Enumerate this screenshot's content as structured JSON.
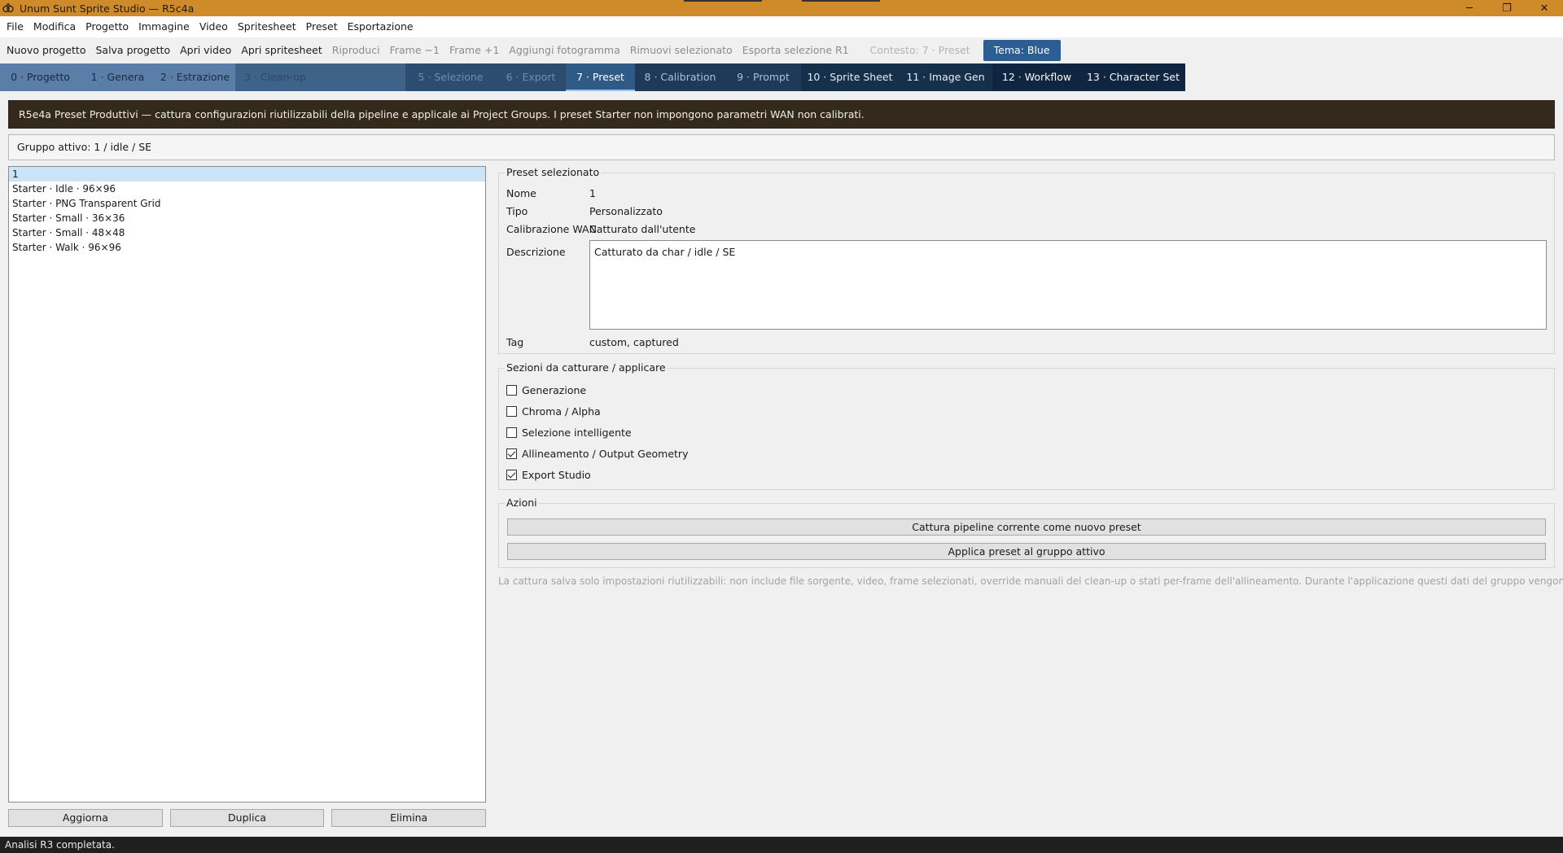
{
  "window": {
    "title": "Unum Sunt Sprite Studio — R5c4a",
    "controls": {
      "minimize": "─",
      "maximize": "❐",
      "close": "✕"
    }
  },
  "menu": [
    "File",
    "Modifica",
    "Progetto",
    "Immagine",
    "Video",
    "Spritesheet",
    "Preset",
    "Esportazione"
  ],
  "toolbar": {
    "items": [
      {
        "label": "Nuovo progetto",
        "enabled": true
      },
      {
        "label": "Salva progetto",
        "enabled": true
      },
      {
        "label": "Apri video",
        "enabled": true
      },
      {
        "label": "Apri spritesheet",
        "enabled": true
      },
      {
        "label": "Riproduci",
        "enabled": false
      },
      {
        "label": "Frame −1",
        "enabled": false
      },
      {
        "label": "Frame +1",
        "enabled": false
      },
      {
        "label": "Aggiungi fotogramma",
        "enabled": false
      },
      {
        "label": "Rimuovi selezionato",
        "enabled": false
      },
      {
        "label": "Esporta selezione R1",
        "enabled": false
      }
    ],
    "context": "Contesto: 7 · Preset",
    "theme_button": "Tema: Blue"
  },
  "tabs": [
    {
      "label": "0 · Progetto",
      "style": "t-light"
    },
    {
      "label": "1 · Genera",
      "style": "t-light"
    },
    {
      "label": "2 · Estrazione",
      "style": "t-light"
    },
    {
      "label": "3 · Clean-up",
      "style": "t-mid"
    },
    {
      "label": "",
      "style": "t-mid"
    },
    {
      "label": "5 · Selezione",
      "style": "t-dark"
    },
    {
      "label": "6 · Export",
      "style": "t-dark"
    },
    {
      "label": "7 · Preset",
      "style": "t-active"
    },
    {
      "label": "8 · Calibration",
      "style": "t-navy"
    },
    {
      "label": "9 · Prompt",
      "style": "t-navy"
    },
    {
      "label": "10 · Sprite Sheet",
      "style": "t-navy2"
    },
    {
      "label": "11 · Image Gen",
      "style": "t-navy2"
    },
    {
      "label": "12 · Workflow",
      "style": "t-navy3"
    },
    {
      "label": "13 · Character Set",
      "style": "t-navy3"
    }
  ],
  "banner": "R5e4a Preset Produttivi — cattura configurazioni riutilizzabili della pipeline e applicale ai Project Groups. I preset Starter non impongono parametri WAN non calibrati.",
  "active_group": "Gruppo attivo: 1 / idle / SE",
  "preset_list": {
    "items": [
      "1",
      "Starter · Idle · 96×96",
      "Starter · PNG Transparent Grid",
      "Starter · Small · 36×36",
      "Starter · Small · 48×48",
      "Starter · Walk · 96×96"
    ],
    "selected_index": 0,
    "buttons": {
      "refresh": "Aggiorna",
      "duplicate": "Duplica",
      "delete": "Elimina"
    }
  },
  "selected_preset": {
    "legend": "Preset selezionato",
    "name_label": "Nome",
    "name_value": "1",
    "type_label": "Tipo",
    "type_value": "Personalizzato",
    "wan_label": "Calibrazione WAN",
    "wan_value": "Catturato dall'utente",
    "desc_label": "Descrizione",
    "desc_value": "Catturato da char / idle / SE",
    "tag_label": "Tag",
    "tag_value": "custom, captured"
  },
  "sections": {
    "legend": "Sezioni da catturare / applicare",
    "items": [
      {
        "label": "Generazione",
        "checked": false
      },
      {
        "label": "Chroma / Alpha",
        "checked": false
      },
      {
        "label": "Selezione intelligente",
        "checked": false
      },
      {
        "label": "Allineamento / Output Geometry",
        "checked": true
      },
      {
        "label": "Export Studio",
        "checked": true
      }
    ]
  },
  "actions": {
    "legend": "Azioni",
    "capture": "Cattura pipeline corrente come nuovo preset",
    "apply": "Applica preset al gruppo attivo"
  },
  "note": "La cattura salva solo impostazioni riutilizzabili: non include file sorgente, video, frame selezionati, override manuali del clean-up o stati per-frame dell'allineamento. Durante l'applicazione questi dati del gruppo vengono preservati.",
  "status": "Analisi R3 completata."
}
